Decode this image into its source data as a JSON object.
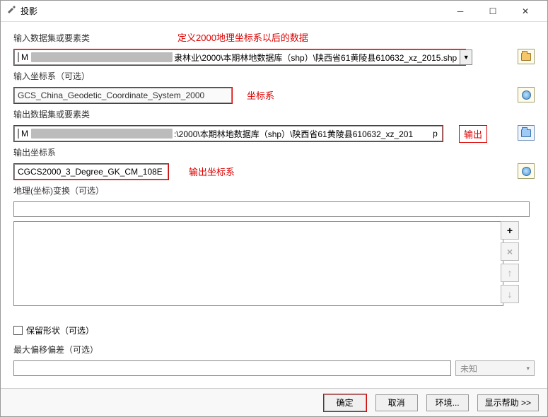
{
  "window": {
    "title": "投影"
  },
  "annotations": {
    "define": "定义2000地理坐标系以后的数据",
    "coord": "坐标系",
    "output": "输出",
    "out_coord": "输出坐标系"
  },
  "labels": {
    "input_ds": "输入数据集或要素类",
    "input_cs": "输入坐标系（可选）",
    "output_ds": "输出数据集或要素类",
    "output_cs": "输出坐标系",
    "geo_trans": "地理(坐标)变换（可选）",
    "keep_shape": "保留形状（可选）",
    "max_offset": "最大偏移偏差（可选）"
  },
  "fields": {
    "input_ds_prefix": "M",
    "input_ds_visible_suffix": "隶林业\\2000\\本期林地数据库（shp）\\陕西省61黄陵县610632_xz_2015.shp",
    "input_cs": "GCS_China_Geodetic_Coordinate_System_2000",
    "output_ds_prefix": "M",
    "output_ds_visible_mid": ":\\2000\\本期林地数据库（shp）\\陕西省61黄陵县610632_xz_201",
    "output_ds_visible_end": "p",
    "output_cs": "CGCS2000_3_Degree_GK_CM_108E",
    "geo_trans": "",
    "max_offset_unit": "未知"
  },
  "buttons": {
    "ok": "确定",
    "cancel": "取消",
    "env": "环境...",
    "help": "显示帮助 >>"
  }
}
